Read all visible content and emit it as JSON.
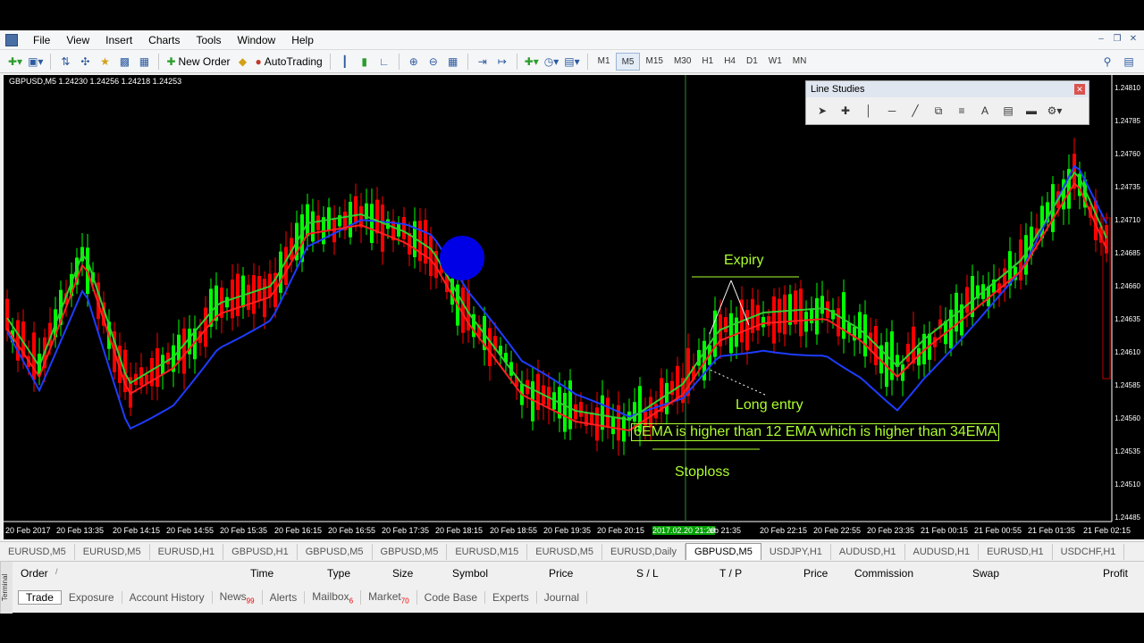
{
  "menu": [
    "File",
    "View",
    "Insert",
    "Charts",
    "Tools",
    "Window",
    "Help"
  ],
  "toolbar": {
    "new_order": "New Order",
    "auto_trading": "AutoTrading",
    "timeframes": [
      "M1",
      "M5",
      "M15",
      "M30",
      "H1",
      "H4",
      "D1",
      "W1",
      "MN"
    ],
    "active_timeframe": "M5"
  },
  "chart": {
    "symbol_info": "GBPUSD,M5  1.24230 1.24256 1.24218 1.24253",
    "price_labels": [
      "1.24810",
      "1.24785",
      "1.24760",
      "1.24735",
      "1.24710",
      "1.24685",
      "1.24660",
      "1.24635",
      "1.24610",
      "1.24585",
      "1.24560",
      "1.24535",
      "1.24510",
      "1.24485"
    ],
    "time_labels": [
      "20 Feb 2017",
      "20 Feb 13:35",
      "20 Feb 14:15",
      "20 Feb 14:55",
      "20 Feb 15:35",
      "20 Feb 16:15",
      "20 Feb 16:55",
      "20 Feb 17:35",
      "20 Feb 18:15",
      "20 Feb 18:55",
      "20 Feb 19:35",
      "20 Feb 20:15",
      "2017.02.20 21:20",
      "eb 21:35",
      "20 Feb 22:15",
      "20 Feb 22:55",
      "20 Feb 23:35",
      "21 Feb 00:15",
      "21 Feb 00:55",
      "21 Feb 01:35",
      "21 Feb 02:15"
    ],
    "annotations": {
      "expiry": "Expiry",
      "long_entry": "Long entry",
      "condition": "6EMA is higher than 12 EMA which is higher than 34EMA",
      "stoploss": "Stoploss"
    },
    "colors": {
      "bull": "#00ff00",
      "bear": "#ff0000",
      "ema_fast": "#32cd32",
      "ema_mid": "#ff2020",
      "ema_slow": "#1e3cff",
      "annotation": "#adff2f"
    }
  },
  "line_studies": {
    "title": "Line Studies",
    "tools": [
      "cursor-icon",
      "crosshair-icon",
      "vertical-line-icon",
      "horizontal-line-icon",
      "trendline-icon",
      "fibo-fan-icon",
      "fibo-retracement-icon",
      "text-icon",
      "text-label-icon",
      "rectangle-icon",
      "more-tools-icon"
    ]
  },
  "chart_tabs": [
    "EURUSD,M5",
    "EURUSD,M5",
    "EURUSD,H1",
    "GBPUSD,H1",
    "GBPUSD,M5",
    "GBPUSD,M5",
    "EURUSD,M15",
    "EURUSD,M5",
    "EURUSD,Daily",
    "GBPUSD,M5",
    "USDJPY,H1",
    "AUDUSD,H1",
    "AUDUSD,H1",
    "EURUSD,H1",
    "USDCHF,H1"
  ],
  "active_chart_tab": 9,
  "terminal": {
    "side_label": "Terminal",
    "columns": [
      "Order",
      "/",
      "Time",
      "Type",
      "Size",
      "Symbol",
      "Price",
      "S / L",
      "T / P",
      "Price",
      "Commission",
      "Swap",
      "Profit"
    ],
    "tabs": [
      {
        "label": "Trade",
        "badge": ""
      },
      {
        "label": "Exposure",
        "badge": ""
      },
      {
        "label": "Account History",
        "badge": ""
      },
      {
        "label": "News",
        "badge": "99"
      },
      {
        "label": "Alerts",
        "badge": ""
      },
      {
        "label": "Mailbox",
        "badge": "6"
      },
      {
        "label": "Market",
        "badge": "70"
      },
      {
        "label": "Code Base",
        "badge": ""
      },
      {
        "label": "Experts",
        "badge": ""
      },
      {
        "label": "Journal",
        "badge": ""
      }
    ],
    "active_tab": 0
  }
}
